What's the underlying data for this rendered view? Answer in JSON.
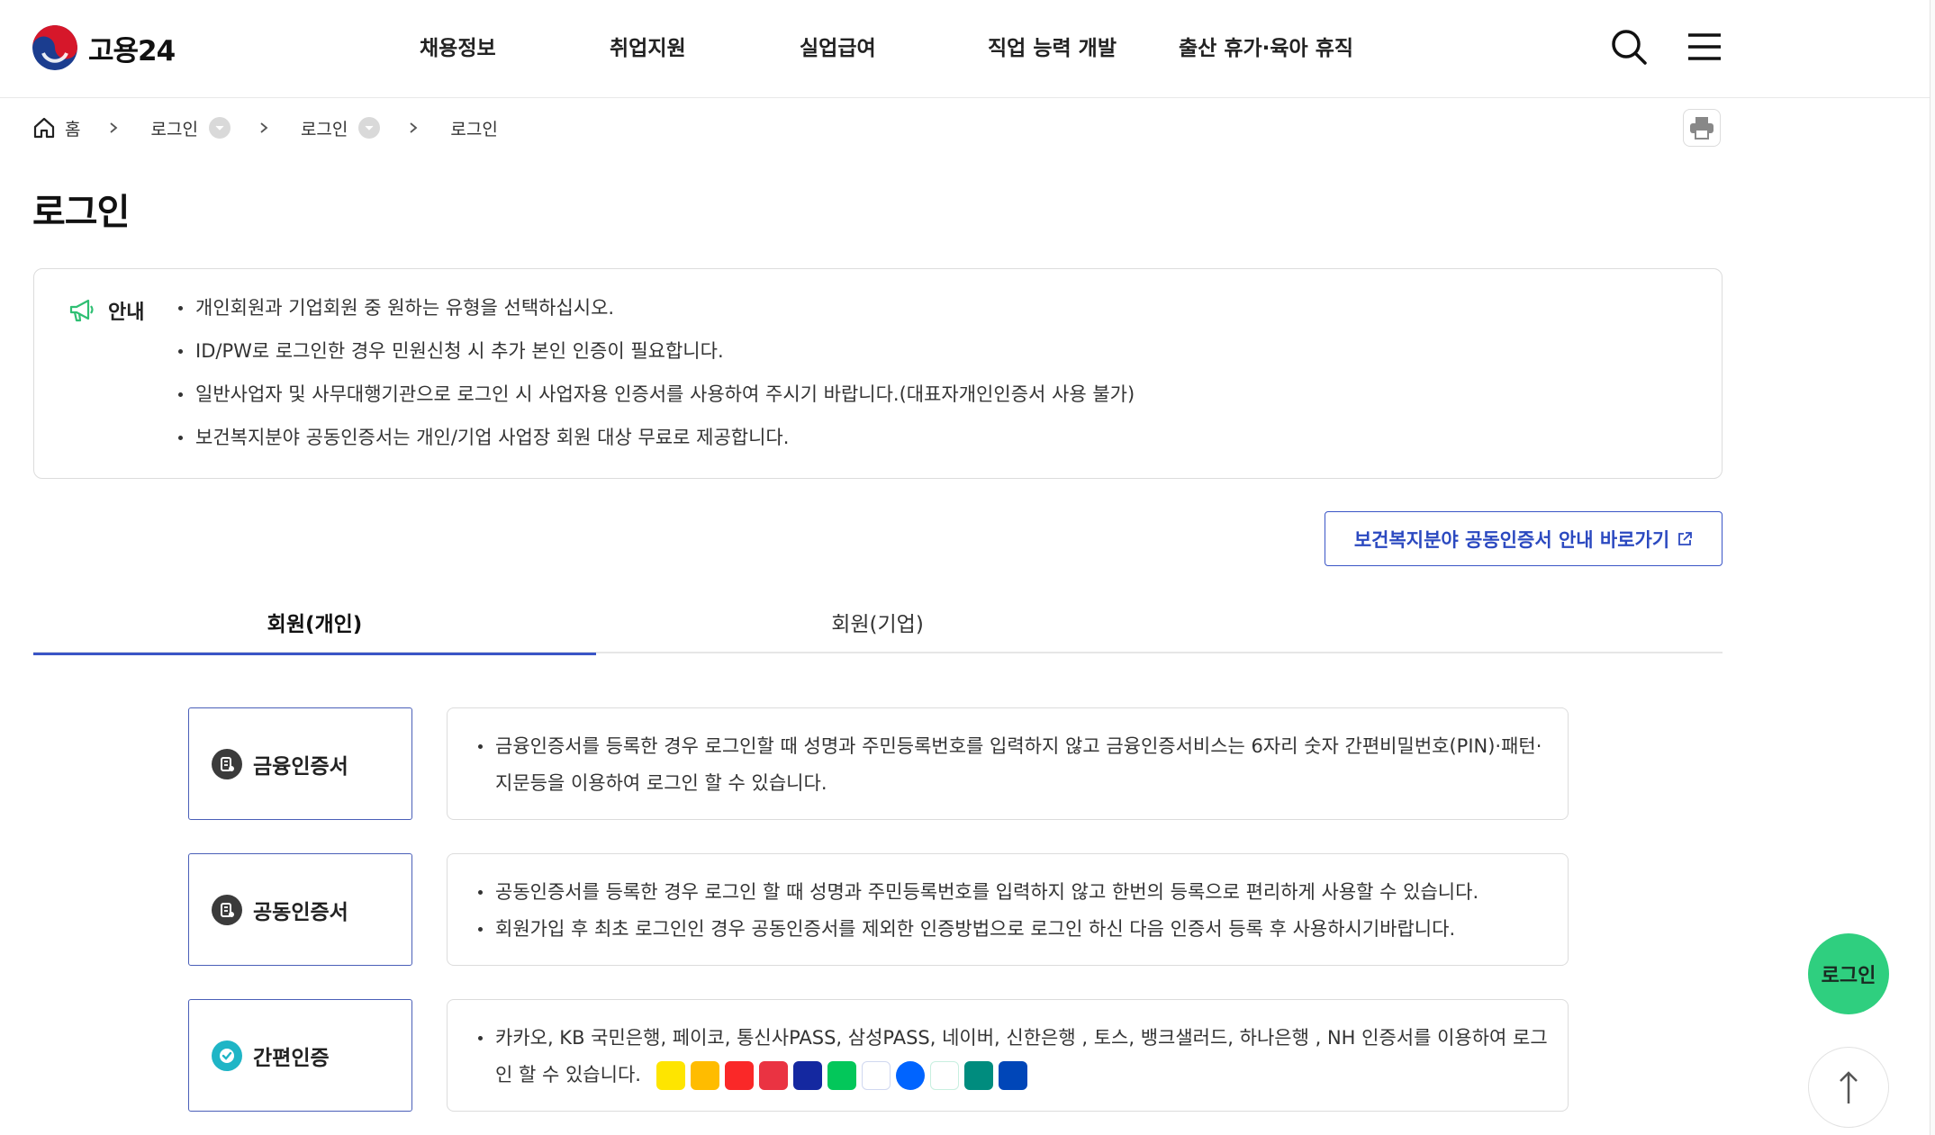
{
  "header": {
    "logo_text": "고용24",
    "nav": [
      "채용정보",
      "취업지원",
      "실업급여",
      "직업 능력 개발",
      "출산 휴가·육아 휴직"
    ]
  },
  "breadcrumb": {
    "home": "홈",
    "items": [
      "로그인",
      "로그인",
      "로그인"
    ]
  },
  "page_title": "로그인",
  "notice": {
    "label": "안내",
    "items": [
      "개인회원과 기업회원 중 원하는 유형을 선택하십시오.",
      "ID/PW로 로그인한 경우 민원신청 시 추가 본인 인증이 필요합니다.",
      "일반사업자 및 사무대행기관으로 로그인 시 사업자용 인증서를 사용하여 주시기 바랍니다.(대표자개인인증서 사용 불가)",
      "보건복지분야 공동인증서는 개인/기업 사업장 회원 대상 무료로 제공합니다."
    ]
  },
  "guide_link": "보건복지분야 공동인증서 안내 바로가기",
  "tabs": [
    "회원(개인)",
    "회원(기업)"
  ],
  "methods": [
    {
      "label": "금융인증서",
      "desc": [
        "금융인증서를 등록한 경우 로그인할 때 성명과 주민등록번호를 입력하지 않고 금융인증서비스는 6자리 숫자 간편비밀번호(PIN)·패턴·지문등을 이용하여 로그인 할 수 있습니다."
      ]
    },
    {
      "label": "공동인증서",
      "desc": [
        "공동인증서를 등록한 경우 로그인 할 때 성명과 주민등록번호를 입력하지 않고 한번의 등록으로 편리하게 사용할 수 있습니다.",
        "회원가입 후 최초 로그인인 경우 공동인증서를 제외한 인증방법으로 로그인 하신 다음 인증서 등록 후 사용하시기바랍니다."
      ]
    },
    {
      "label": "간편인증",
      "desc": [
        "카카오, KB 국민은행, 페이코, 통신사PASS, 삼성PASS, 네이버, 신한은행 , 토스, 뱅크샐러드, 하나은행 , NH 인증서를 이용하여 로그인 할 수 있습니다."
      ]
    }
  ],
  "simple_auth_icons": [
    "kakao-icon",
    "kb-icon",
    "payco-icon",
    "pass-icon",
    "samsung-pass-icon",
    "naver-icon",
    "shinhan-icon",
    "toss-icon",
    "banksalad-icon",
    "hana-icon",
    "nh-icon"
  ],
  "float_login": "로그인",
  "colors": {
    "accent": "#3a55c6",
    "green": "#2fcf7f"
  }
}
